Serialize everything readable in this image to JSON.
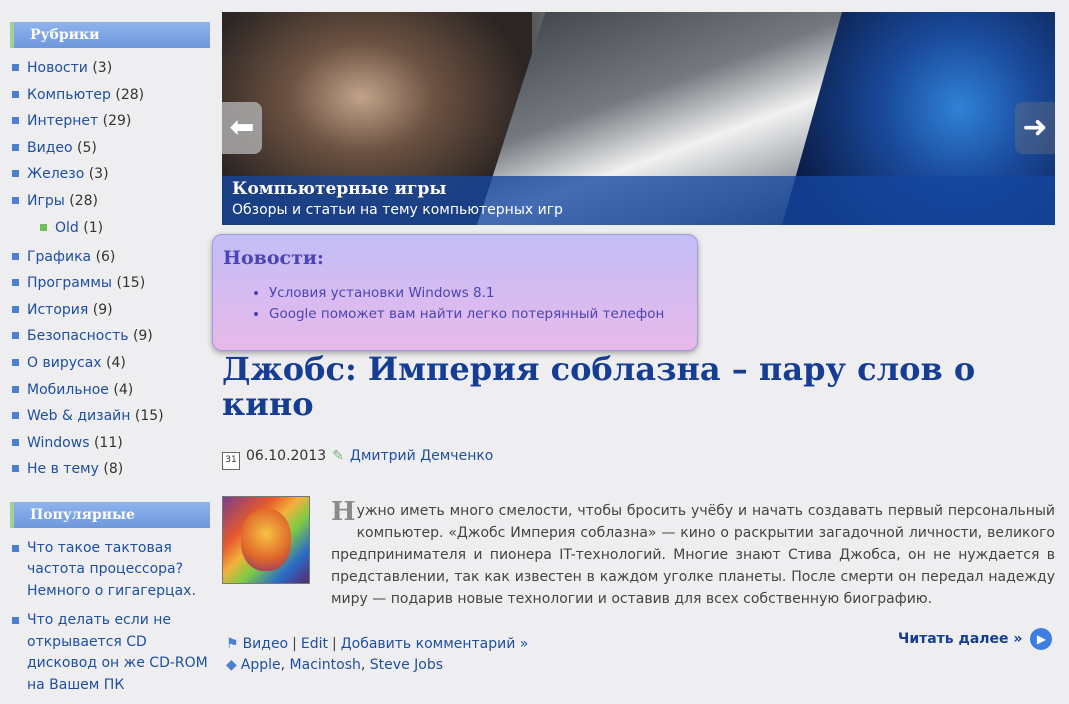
{
  "sidebar": {
    "categories_title": "Рубрики",
    "categories": [
      {
        "label": "Новости",
        "count": "(3)"
      },
      {
        "label": "Компьютер",
        "count": "(28)"
      },
      {
        "label": "Интернет",
        "count": "(29)"
      },
      {
        "label": "Видео",
        "count": "(5)"
      },
      {
        "label": "Железо",
        "count": "(3)"
      },
      {
        "label": "Игры",
        "count": "(28)"
      },
      {
        "label": "Old",
        "count": "(1)"
      },
      {
        "label": "Графика",
        "count": "(6)"
      },
      {
        "label": "Программы",
        "count": "(15)"
      },
      {
        "label": "История",
        "count": "(9)"
      },
      {
        "label": "Безопасность",
        "count": "(9)"
      },
      {
        "label": "О вирусах",
        "count": "(4)"
      },
      {
        "label": "Мобильное",
        "count": "(4)"
      },
      {
        "label": "Web & дизайн",
        "count": "(15)"
      },
      {
        "label": "Windows",
        "count": "(11)"
      },
      {
        "label": "Не в тему",
        "count": "(8)"
      }
    ],
    "popular_title": "Популярные",
    "popular": [
      "Что такое тактовая частота процессора? Немного о гигагерцах.",
      "Что делать если не открывается CD дисковод он же CD-ROM на Вашем ПК"
    ]
  },
  "slider": {
    "arrow_left": "⬅",
    "arrow_right": "➜",
    "caption_title": "Компьютерные игры",
    "caption_subtitle": "Обзоры и статьи на тему компьютерных игр"
  },
  "news": {
    "title": "Новости:",
    "items": [
      "Условия установки Windows 8.1",
      "Google поможет вам найти легко потерянный телефон"
    ]
  },
  "post": {
    "title": "Джобс: Империя соблазна – пару слов о кино",
    "date": "06.10.2013",
    "calendar_day": "31",
    "author": "Дмитрий Демченко",
    "dropcap": "Н",
    "text": "ужно иметь много смелости, чтобы бросить учёбу и начать создавать первый персональный компьютер. «Джобс Империя соблазна» — кино о раскрытии загадочной личности, великого предпринимателя и пионера IT-технологий. Многие знают Стива Джобса, он не нуждается в представлении, так как известен в каждом уголке планеты. После смерти он передал надежду миру — подарив новые технологии и оставив для всех собственную биографию.",
    "category_link": "Видео",
    "edit_link": "Edit",
    "comment_link": "Добавить комментарий »",
    "separator": "|",
    "tags": [
      "Apple",
      "Macintosh",
      "Steve Jobs"
    ],
    "tag_separator": ",",
    "read_more": "Читать далее »",
    "read_more_icon": "▶"
  },
  "colors": {
    "accent": "#163d94",
    "link": "#1f4fa0",
    "widget_header": "#7ea5e6",
    "news_box_top": "#c3bef7",
    "news_box_bottom": "#e8b9ea"
  }
}
